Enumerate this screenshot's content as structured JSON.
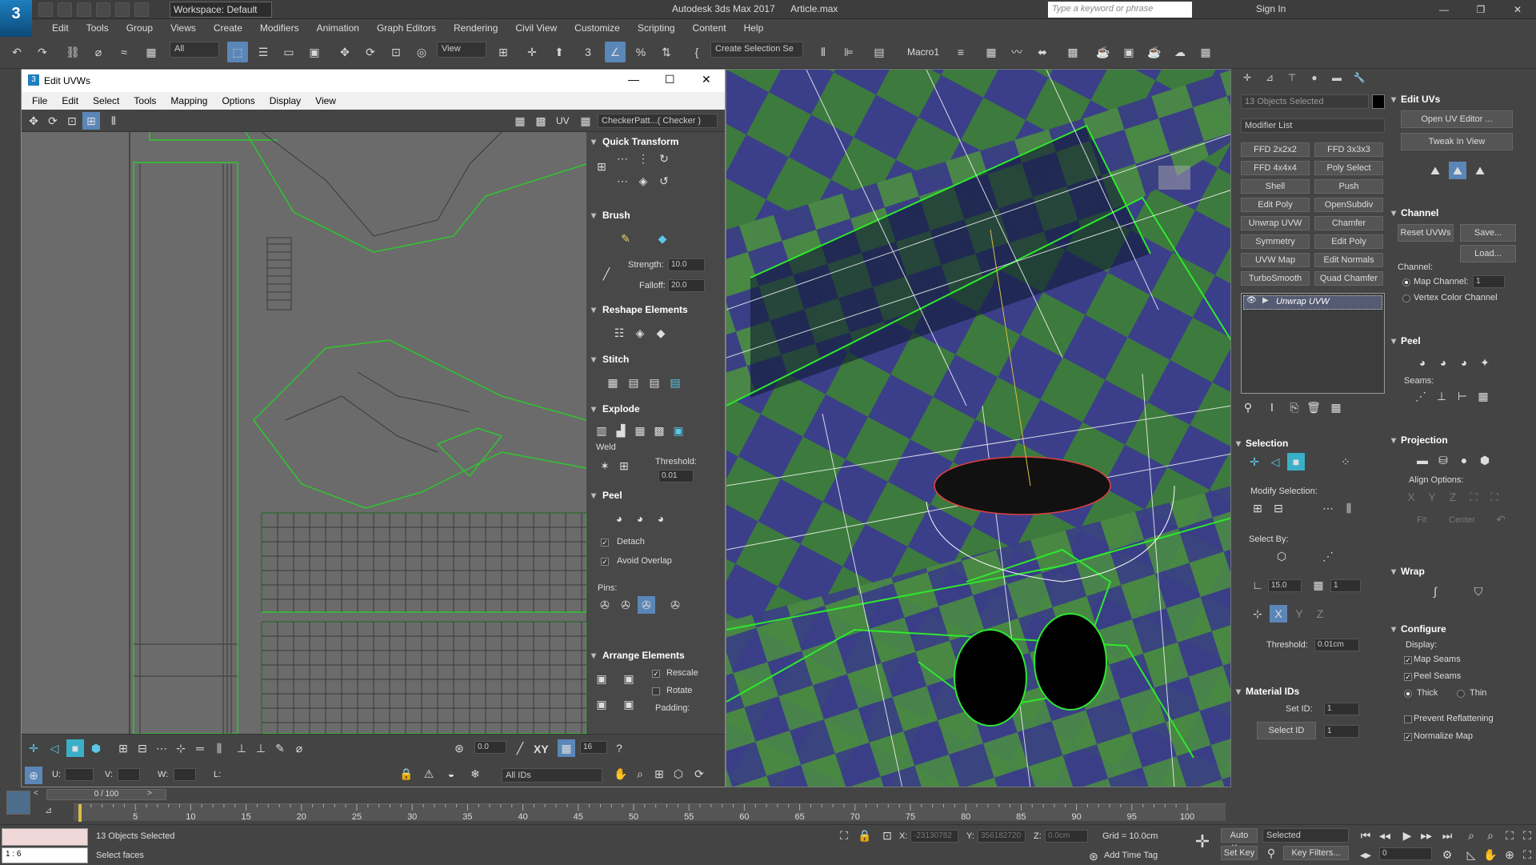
{
  "app": {
    "logo_text": "3",
    "workspace_label": "Workspace: Default",
    "title": "Autodesk 3ds Max 2017      Article.max",
    "search_placeholder": "Type a keyword or phrase",
    "sign_in": "Sign In"
  },
  "menu": [
    "Edit",
    "Tools",
    "Group",
    "Views",
    "Create",
    "Modifiers",
    "Animation",
    "Graph Editors",
    "Rendering",
    "Civil View",
    "Customize",
    "Scripting",
    "Content",
    "Help"
  ],
  "toolbar": {
    "filter": "All",
    "view": "View",
    "selection_set": "Create Selection Se",
    "macro": "Macro1",
    "percent_symbol": "%"
  },
  "uv_editor": {
    "title": "Edit UVWs",
    "menu": [
      "File",
      "Edit",
      "Select",
      "Tools",
      "Mapping",
      "Options",
      "Display",
      "View"
    ],
    "uv_label": "UV",
    "checker": "CheckerPatt...( Checker )",
    "rollouts": {
      "quick_transform": "Quick Transform",
      "brush": "Brush",
      "strength_label": "Strength:",
      "strength_value": "10.0",
      "falloff_label": "Falloff:",
      "falloff_value": "20.0",
      "reshape": "Reshape Elements",
      "stitch": "Stitch",
      "explode": "Explode",
      "weld": "Weld",
      "threshold_label": "Threshold:",
      "threshold_value": "0.01",
      "peel": "Peel",
      "detach": "Detach",
      "avoid_overlap": "Avoid Overlap",
      "pins": "Pins:",
      "arrange": "Arrange Elements",
      "rescale": "Rescale",
      "rotate": "Rotate",
      "padding": "Padding:"
    },
    "bottom": {
      "angle_value": "0.0",
      "xy": "XY",
      "snap_value": "16",
      "u_label": "U:",
      "v_label": "V:",
      "w_label": "W:",
      "l_label": "L:",
      "ids": "All IDs"
    }
  },
  "command_panel": {
    "object_selection": "13 Objects Selected",
    "modifier_list": "Modifier List",
    "modifiers": [
      "FFD 2x2x2",
      "FFD 3x3x3",
      "FFD 4x4x4",
      "Poly Select",
      "Shell",
      "Push",
      "Edit Poly",
      "OpenSubdiv",
      "Unwrap UVW",
      "Chamfer",
      "Symmetry",
      "Edit Poly",
      "UVW Map",
      "Edit Normals",
      "TurboSmooth",
      "Quad Chamfer"
    ],
    "stack_item": "Unwrap UVW",
    "selection": {
      "title": "Selection",
      "modify_selection": "Modify Selection:",
      "select_by": "Select By:",
      "angle_value": "15.0",
      "count_value": "1",
      "threshold_label": "Threshold:",
      "threshold_value": "0.01cm"
    },
    "material_ids": {
      "title": "Material IDs",
      "set_id_label": "Set ID:",
      "set_id_value": "1",
      "select_id_button": "Select ID",
      "select_id_value": "1"
    }
  },
  "uv_rollout": {
    "edit_uvs": "Edit UVs",
    "open_editor": "Open UV Editor ...",
    "tweak_in_view": "Tweak In View",
    "channel": "Channel",
    "reset_uvws": "Reset UVWs",
    "save": "Save...",
    "load": "Load...",
    "channel_label": "Channel:",
    "map_channel": "Map Channel:",
    "map_channel_value": "1",
    "vertex_color": "Vertex Color Channel",
    "peel": "Peel",
    "seams": "Seams:",
    "projection": "Projection",
    "align_options": "Align Options:",
    "fit": "Fit",
    "center": "Center",
    "wrap": "Wrap",
    "configure": "Configure",
    "display": "Display:",
    "map_seams": "Map Seams",
    "peel_seams": "Peel Seams",
    "thick": "Thick",
    "thin": "Thin",
    "prevent_reflattening": "Prevent Reflattening",
    "normalize_map": "Normalize Map"
  },
  "timeline": {
    "frame": "0 / 100",
    "ticks": [
      "5",
      "10",
      "15",
      "20",
      "25",
      "30",
      "35",
      "40",
      "45",
      "50",
      "55",
      "60",
      "65",
      "70",
      "75",
      "80",
      "85",
      "90",
      "95",
      "100"
    ]
  },
  "status": {
    "selected": "13 Objects Selected",
    "prompt": "Select faces",
    "x_label": "X:",
    "x_value": "-23130782",
    "y_label": "Y:",
    "y_value": "356182720",
    "z_label": "Z:",
    "z_value": "0.0cm",
    "grid": "Grid = 10.0cm",
    "add_time_tag": "Add Time Tag",
    "auto_key": "Auto Key",
    "set_key": "Set Key",
    "key_mode": "Selected",
    "key_filters": "Key Filters...",
    "frame_value": "0",
    "maxscript": "1 : 6"
  }
}
